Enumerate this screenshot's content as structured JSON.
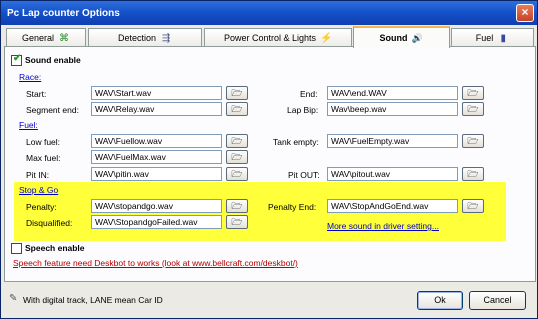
{
  "window": {
    "title": "Pc Lap counter Options",
    "close_glyph": "×"
  },
  "tabs": [
    {
      "label": "General",
      "icon": "general-grid-icon",
      "glyph": "⌘"
    },
    {
      "label": "Detection",
      "icon": "detection-icon",
      "glyph": "⇶"
    },
    {
      "label": "Power Control & Lights",
      "icon": "lightning-icon",
      "glyph": "⚡"
    },
    {
      "label": "Sound",
      "icon": "speaker-icon",
      "glyph": "🔊"
    },
    {
      "label": "Fuel",
      "icon": "fuel-pump-icon",
      "glyph": "▮"
    }
  ],
  "sound": {
    "enable_label": "Sound enable",
    "enabled": true,
    "race": {
      "header": "Race:",
      "start_label": "Start:",
      "start_value": "WAV\\Start.wav",
      "end_label": "End:",
      "end_value": "WAV\\end.WAV",
      "segment_end_label": "Segment end:",
      "segment_end_value": "WAV\\Relay.wav",
      "lap_bip_label": "Lap Bip:",
      "lap_bip_value": "Wav\\beep.wav"
    },
    "fuel": {
      "header": "Fuel:",
      "low_fuel_label": "Low fuel:",
      "low_fuel_value": "WAV\\Fuellow.wav",
      "tank_empty_label": "Tank empty:",
      "tank_empty_value": "WAV\\FuelEmpty.wav",
      "max_fuel_label": "Max fuel:",
      "max_fuel_value": "WAV\\FuelMax.wav",
      "pit_in_label": "Pit IN:",
      "pit_in_value": "WAV\\pitin.wav",
      "pit_out_label": "Pit OUT:",
      "pit_out_value": "WAV\\pitout.wav"
    },
    "stop_go": {
      "header": "Stop & Go",
      "penalty_label": "Penalty:",
      "penalty_value": "WAV\\stopandgo.wav",
      "penalty_end_label": "Penalty End:",
      "penalty_end_value": "WAV\\StopAndGoEnd.wav",
      "disqualified_label": "Disqualified:",
      "disqualified_value": "WAV\\StopandgoFailed.wav",
      "more_link": "More sound in driver setting..."
    },
    "highlight_color": "#ffff3a"
  },
  "speech": {
    "enable_label": "Speech enable",
    "enabled": false,
    "note": "Speech feature need Deskbot to works (look at www.bellcraft.com/deskbot/)"
  },
  "browse_glyph": "🗁",
  "footer": {
    "hint_icon": "tools-icon",
    "hint_glyph": "✎",
    "hint": "With digital track, LANE mean Car ID",
    "ok_label": "Ok",
    "cancel_label": "Cancel"
  },
  "colors": {
    "title_bar": "#1450c8",
    "active_tab_accent": "#f7b64c"
  }
}
